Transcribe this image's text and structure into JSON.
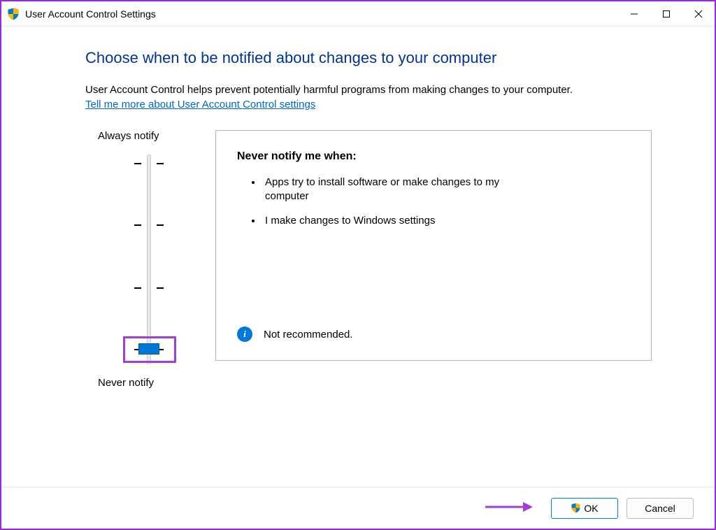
{
  "window": {
    "title": "User Account Control Settings"
  },
  "main": {
    "heading": "Choose when to be notified about changes to your computer",
    "description": "User Account Control helps prevent potentially harmful programs from making changes to your computer.",
    "link": "Tell me more about User Account Control settings"
  },
  "slider": {
    "top_label": "Always notify",
    "bottom_label": "Never notify",
    "levels": 4,
    "current_level": 0
  },
  "panel": {
    "title": "Never notify me when:",
    "bullets": [
      "Apps try to install software or make changes to my computer",
      "I make changes to Windows settings"
    ],
    "info_text": "Not recommended."
  },
  "footer": {
    "ok_label": "OK",
    "cancel_label": "Cancel"
  },
  "icons": {
    "shield": "shield-icon",
    "info": "info-icon",
    "minimize": "minimize-icon",
    "maximize": "maximize-icon",
    "close": "close-icon"
  },
  "colors": {
    "accent": "#0078d7",
    "heading": "#003399",
    "annotation": "#a43cd6"
  }
}
